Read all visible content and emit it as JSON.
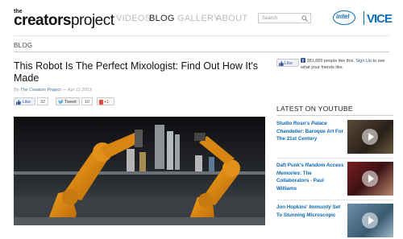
{
  "header": {
    "logo_small": "the",
    "logo_bold": "creators",
    "logo_light": "project",
    "nav": [
      "VIDEOS",
      "BLOG",
      "GALLERY",
      "ABOUT"
    ],
    "active_nav": "BLOG",
    "search_placeholder": "Search",
    "partner_intel": "intel",
    "partner_vice": "VICE"
  },
  "breadcrumb": "BLOG",
  "article": {
    "title": "This Robot Is The Perfect Mixologist: Find Out How It's Made",
    "byline_prefix": "By ",
    "author": "The Creators Project",
    "date": " — Apr 11 2013",
    "shares": {
      "like_label": "Like",
      "like_count": "32",
      "tweet_label": "Tweet",
      "tweet_count": "10",
      "plus_label": "+1"
    }
  },
  "facebook": {
    "like_label": "Like",
    "count_text": "381,665 people like this.",
    "signup_text": "Sign Up",
    "rest_text": "to see what your friends like."
  },
  "youtube": {
    "heading": "LATEST ON YOUTUBE",
    "videos": [
      {
        "pre": "Studio Roso's ",
        "em": "Palace Chandelier",
        "post": ": Baroque Art For The 21st Century"
      },
      {
        "pre": "Daft Punk's ",
        "em": "Random Access Memories",
        "post": ": The Collaborators - Paul Williams"
      },
      {
        "pre": "Jon Hopkins' ",
        "em": "Immunity",
        "post": " Set To Stunning Microscopic"
      }
    ]
  },
  "colors": {
    "link": "#0b68b8",
    "facebook": "#3b5998",
    "intel": "#0b6fb8"
  }
}
